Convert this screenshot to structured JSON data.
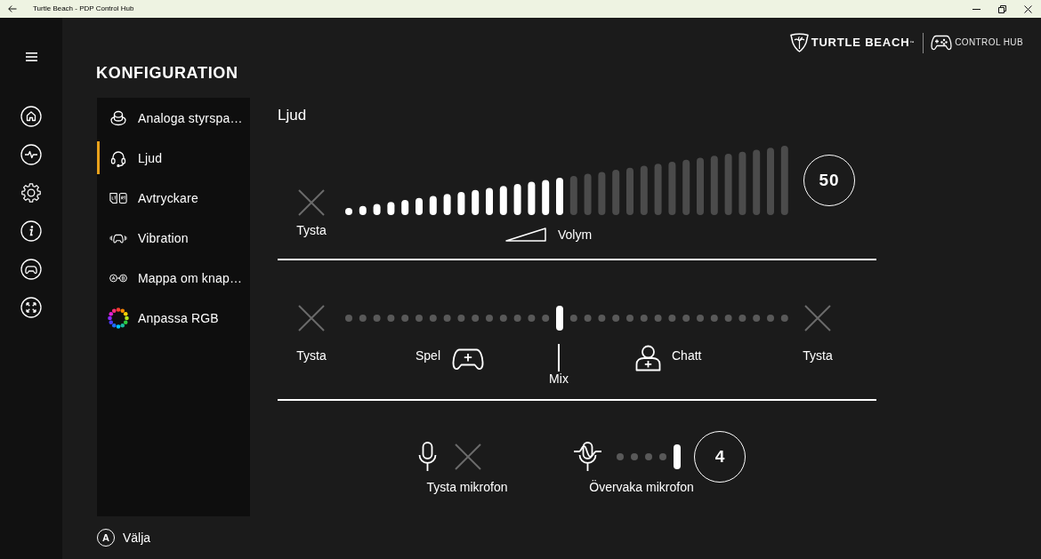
{
  "title_bar": {
    "title": "Turtle Beach - PDP Control Hub"
  },
  "logo": {
    "brand": "TURTLE BEACH$^{™}$",
    "product": "CONTROL HUB"
  },
  "heading": "KONFIGURATION",
  "sidebar": {
    "items": [
      {
        "label": "Analoga styrspa…",
        "selected": false
      },
      {
        "label": "Ljud",
        "selected": true
      },
      {
        "label": "Avtryckare",
        "selected": false
      },
      {
        "label": "Vibration",
        "selected": false
      },
      {
        "label": "Mappa om knap…",
        "selected": false
      },
      {
        "label": "Anpassa RGB",
        "selected": false
      }
    ]
  },
  "footer_hint": {
    "key": "A",
    "label": "Välja"
  },
  "panel": {
    "title": "Ljud",
    "volume": {
      "mute": {
        "label": "Tysta",
        "muted": false
      },
      "level": 0.5,
      "label": "Volym",
      "reading": "50"
    },
    "mix": {
      "game_mute": {
        "label": "Tysta",
        "muted": false
      },
      "level": 0.5,
      "game_label": "Spel",
      "center_label": "Mix",
      "chat_label": "Chatt",
      "chat_mute": {
        "label": "Tysta",
        "muted": false
      }
    },
    "microphone": {
      "mute": {
        "label": "Tysta mikrofon",
        "muted": false
      },
      "monitor": {
        "label": "Övervaka mikrofon",
        "level": 1,
        "reading": "4"
      }
    }
  }
}
